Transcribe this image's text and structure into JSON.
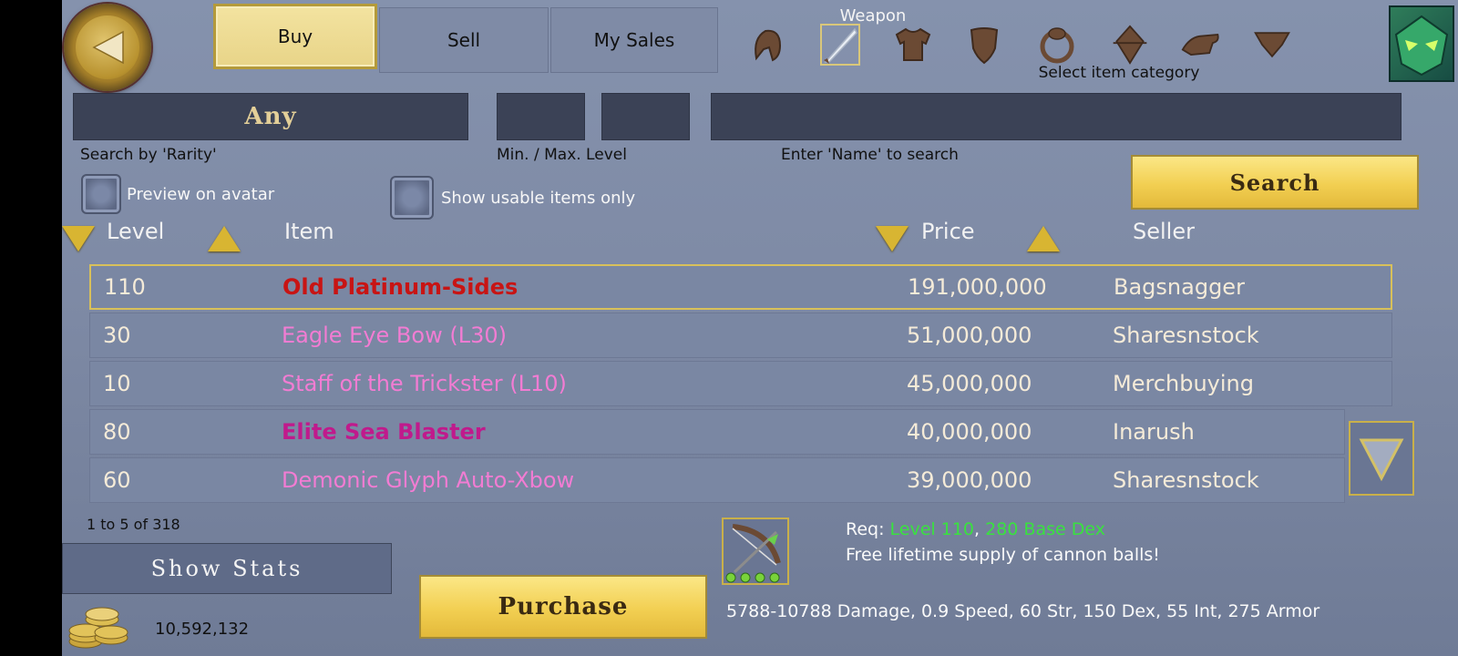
{
  "nav": {
    "back_icon": "back-arrow-icon"
  },
  "tabs": [
    {
      "label": "Buy",
      "active": true
    },
    {
      "label": "Sell",
      "active": false
    },
    {
      "label": "My Sales",
      "active": false
    }
  ],
  "categories": {
    "selected_label": "Weapon",
    "caption": "Select item category",
    "icons": [
      "helmet-icon",
      "weapon-icon",
      "armor-icon",
      "shield-icon",
      "ring-icon",
      "amulet-icon",
      "gloves-icon",
      "cape-icon"
    ]
  },
  "filters": {
    "rarity_value": "Any",
    "rarity_label": "Search by 'Rarity'",
    "min_level": "",
    "max_level": "",
    "level_label": "Min. / Max. Level",
    "name_value": "",
    "name_label": "Enter 'Name' to search",
    "search_button": "Search",
    "preview_label": "Preview on avatar",
    "usable_label": "Show usable items only"
  },
  "table": {
    "headers": {
      "level": "Level",
      "item": "Item",
      "price": "Price",
      "seller": "Seller"
    },
    "rows": [
      {
        "level": "110",
        "item": "Old Platinum-Sides",
        "price": "191,000,000",
        "seller": "Bagsnagger",
        "rarity_color": "#c81414",
        "selected": true
      },
      {
        "level": "30",
        "item": "Eagle Eye Bow (L30)",
        "price": "51,000,000",
        "seller": "Sharesnstock",
        "rarity_color": "#f27cd3",
        "selected": false
      },
      {
        "level": "10",
        "item": "Staff of the Trickster (L10)",
        "price": "45,000,000",
        "seller": "Merchbuying",
        "rarity_color": "#f27cd3",
        "selected": false
      },
      {
        "level": "80",
        "item": "Elite Sea Blaster",
        "price": "40,000,000",
        "seller": "Inarush",
        "rarity_color": "#c01a8c",
        "selected": false
      },
      {
        "level": "60",
        "item": "Demonic Glyph Auto-Xbow",
        "price": "39,000,000",
        "seller": "Sharesnstock",
        "rarity_color": "#f27cd3",
        "selected": false
      }
    ],
    "count_text": "1 to 5 of 318"
  },
  "footer": {
    "show_stats": "Show Stats",
    "gold": "10,592,132",
    "purchase": "Purchase",
    "req_prefix": "Req:",
    "req_level": "Level 110",
    "req_sep": ",",
    "req_dex": "280 Base Dex",
    "description": "Free lifetime supply of cannon balls!",
    "stats": "5788-10788 Damage, 0.9 Speed, 60 Str, 150 Dex, 55 Int, 275 Armor"
  },
  "colors": {
    "accent_gold": "#f2cf52",
    "panel": "#7f8ba6",
    "field": "#3b4256"
  }
}
